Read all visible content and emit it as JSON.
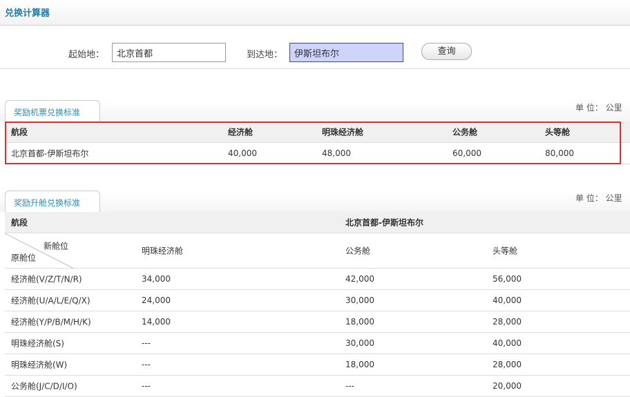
{
  "title": "兑换计算器",
  "search": {
    "from_label": "起始地：",
    "from_value": "北京首都",
    "to_label": "到达地：",
    "to_value": "伊斯坦布尔",
    "query_button": "查询"
  },
  "award": {
    "tab": "奖励机票兑换标准",
    "unit": "单 位： 公里",
    "headers": [
      "航段",
      "经济舱",
      "明珠经济舱",
      "公务舱",
      "头等舱"
    ],
    "rows": [
      [
        "北京首都-伊斯坦布尔",
        "40,000",
        "48,000",
        "60,000",
        "80,000"
      ]
    ]
  },
  "upgrade": {
    "tab": "奖励升舱兑换标准",
    "unit": "单 位： 公里",
    "route_label": "航段",
    "route": "北京首都-伊斯坦布尔",
    "corner_new": "新舱位",
    "corner_old": "原舱位",
    "headers": [
      "明珠经济舱",
      "公务舱",
      "头等舱"
    ],
    "rows": [
      [
        "经济舱(V/Z/T/N/R)",
        "34,000",
        "42,000",
        "56,000"
      ],
      [
        "经济舱(U/A/L/E/Q/X)",
        "24,000",
        "30,000",
        "40,000"
      ],
      [
        "经济舱(Y/P/B/M/H/K)",
        "14,000",
        "18,000",
        "28,000"
      ],
      [
        "明珠经济舱(S)",
        "---",
        "30,000",
        "40,000"
      ],
      [
        "明珠经济舱(W)",
        "---",
        "18,000",
        "28,000"
      ],
      [
        "公务舱(J/C/D/I/O)",
        "---",
        "---",
        "20,000"
      ]
    ]
  },
  "colors": {
    "accent": "#1f7fa8",
    "highlight": "#d9302c",
    "to_input_bg": "#cfd4fb"
  }
}
